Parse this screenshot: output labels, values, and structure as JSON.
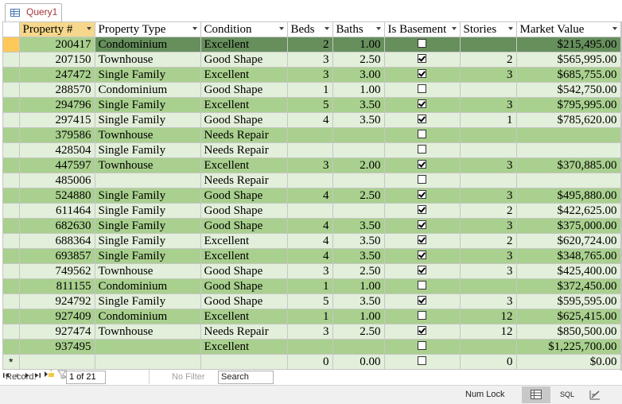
{
  "tab": {
    "label": "Query1",
    "icon": "query-icon"
  },
  "columns": [
    {
      "label": "Property #",
      "align": "right"
    },
    {
      "label": "Property Type",
      "align": "left"
    },
    {
      "label": "Condition",
      "align": "left"
    },
    {
      "label": "Beds",
      "align": "right"
    },
    {
      "label": "Baths",
      "align": "right"
    },
    {
      "label": "Is Basement",
      "align": "center"
    },
    {
      "label": "Stories",
      "align": "right"
    },
    {
      "label": "Market Value",
      "align": "right"
    }
  ],
  "rows": [
    [
      "200417",
      "Condominium",
      "Excellent",
      "2",
      "1.00",
      false,
      "",
      "$215,495.00"
    ],
    [
      "207150",
      "Townhouse",
      "Good Shape",
      "3",
      "2.50",
      true,
      "2",
      "$565,995.00"
    ],
    [
      "247472",
      "Single Family",
      "Excellent",
      "3",
      "3.00",
      true,
      "3",
      "$685,755.00"
    ],
    [
      "288570",
      "Condominium",
      "Good Shape",
      "1",
      "1.00",
      false,
      "",
      "$542,750.00"
    ],
    [
      "294796",
      "Single Family",
      "Excellent",
      "5",
      "3.50",
      true,
      "3",
      "$795,995.00"
    ],
    [
      "297415",
      "Single Family",
      "Good Shape",
      "4",
      "3.50",
      true,
      "1",
      "$785,620.00"
    ],
    [
      "379586",
      "Townhouse",
      "Needs Repair",
      "",
      "",
      false,
      "",
      ""
    ],
    [
      "428504",
      "Single Family",
      "Needs Repair",
      "",
      "",
      false,
      "",
      ""
    ],
    [
      "447597",
      "Townhouse",
      "Excellent",
      "3",
      "2.00",
      true,
      "3",
      "$370,885.00"
    ],
    [
      "485006",
      "",
      "Needs Repair",
      "",
      "",
      false,
      "",
      ""
    ],
    [
      "524880",
      "Single Family",
      "Good Shape",
      "4",
      "2.50",
      true,
      "3",
      "$495,880.00"
    ],
    [
      "611464",
      "Single Family",
      "Good Shape",
      "",
      "",
      true,
      "2",
      "$422,625.00"
    ],
    [
      "682630",
      "Single Family",
      "Good Shape",
      "4",
      "3.50",
      true,
      "3",
      "$375,000.00"
    ],
    [
      "688364",
      "Single Family",
      "Excellent",
      "4",
      "3.50",
      true,
      "2",
      "$620,724.00"
    ],
    [
      "693857",
      "Single Family",
      "Excellent",
      "4",
      "3.50",
      true,
      "3",
      "$348,765.00"
    ],
    [
      "749562",
      "Townhouse",
      "Good Shape",
      "3",
      "2.50",
      true,
      "3",
      "$425,400.00"
    ],
    [
      "811155",
      "Condominium",
      "Good Shape",
      "1",
      "1.00",
      false,
      "",
      "$372,450.00"
    ],
    [
      "924792",
      "Single Family",
      "Good Shape",
      "5",
      "3.50",
      true,
      "3",
      "$595,595.00"
    ],
    [
      "927409",
      "Condominium",
      "Excellent",
      "1",
      "1.00",
      false,
      "12",
      "$625,415.00"
    ],
    [
      "927474",
      "Townhouse",
      "Needs Repair",
      "3",
      "2.50",
      true,
      "12",
      "$850,500.00"
    ],
    [
      "937495",
      "",
      "Excellent",
      "",
      "",
      false,
      "",
      "$1,225,700.00"
    ]
  ],
  "new_row": [
    "",
    "",
    "",
    "0",
    "0.00",
    false,
    "0",
    "$0.00"
  ],
  "new_row_marker": "*",
  "navigation": {
    "record_label": "Record:",
    "position": "1 of 21",
    "filter_label": "No Filter",
    "search_placeholder": "Search"
  },
  "status": {
    "numlock": "Num Lock",
    "sql_label": "SQL"
  },
  "colors": {
    "row_light": "#e2efda",
    "row_dark": "#a9d08e",
    "selected_row": "#668f5c",
    "selected_cell": "#ffc85a",
    "tab_text": "#a4373a"
  }
}
